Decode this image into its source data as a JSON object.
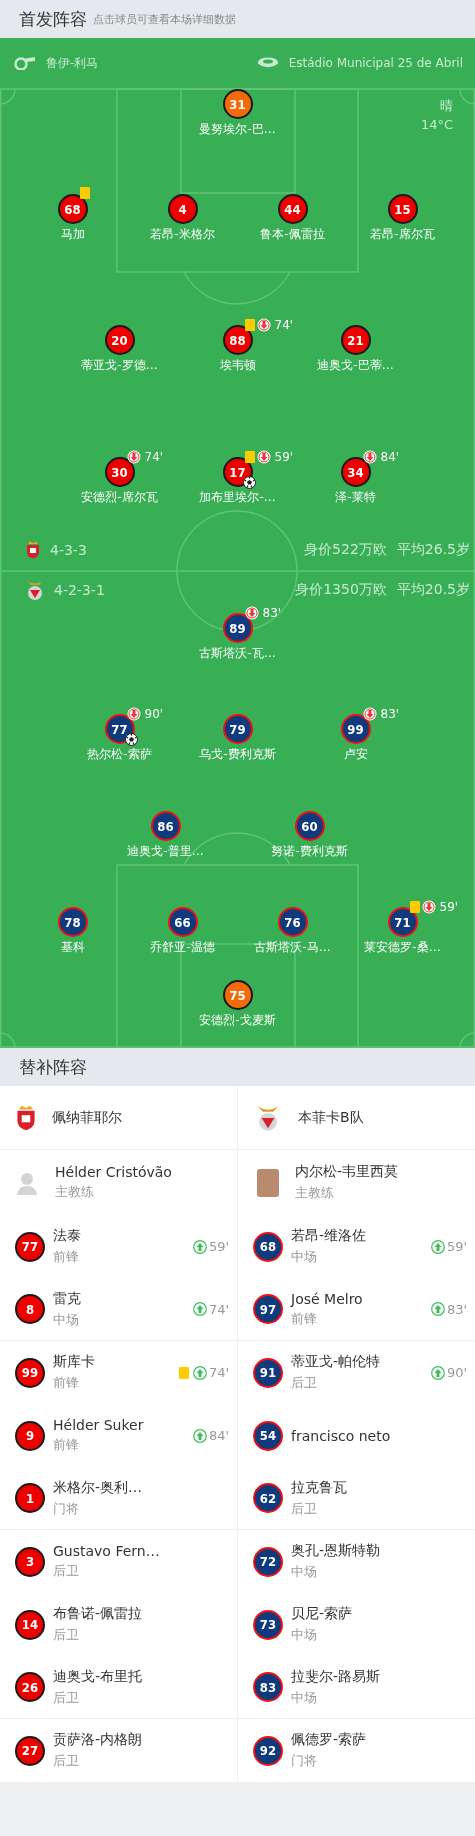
{
  "header": {
    "title": "首发阵容",
    "hint": "点击球员可查看本场详细数据"
  },
  "pitch": {
    "referee": "鲁伊-利马",
    "stadium": "Estádio Municipal 25 de Abril",
    "weather": "晴",
    "temperature": "14°C",
    "home_lines": [
      [
        {
          "number": "31",
          "name": "曼努埃尔-巴…",
          "kind": "goalkeeper",
          "yellow_card": false,
          "goal": false
        }
      ],
      [
        {
          "number": "68",
          "name": "马加",
          "kind": "outfield",
          "yellow_card": true,
          "goal": false
        },
        {
          "number": "4",
          "name": "若昂-米格尔",
          "kind": "outfield",
          "yellow_card": false,
          "goal": false
        },
        {
          "number": "44",
          "name": "鲁本-佩雷拉",
          "kind": "outfield",
          "yellow_card": false,
          "goal": false
        },
        {
          "number": "15",
          "name": "若昂-席尔瓦",
          "kind": "outfield",
          "yellow_card": false,
          "goal": false
        }
      ],
      [
        {
          "number": "20",
          "name": "蒂亚戈-罗德…",
          "kind": "outfield",
          "yellow_card": false,
          "goal": false
        },
        {
          "number": "88",
          "name": "埃韦顿",
          "kind": "outfield",
          "yellow_card": true,
          "subbed_off": "74'",
          "goal": false
        },
        {
          "number": "21",
          "name": "迪奥戈-巴蒂…",
          "kind": "outfield",
          "yellow_card": false,
          "goal": false
        }
      ],
      [
        {
          "number": "30",
          "name": "安德烈-席尔瓦",
          "kind": "outfield",
          "yellow_card": false,
          "subbed_off": "74'",
          "goal": false
        },
        {
          "number": "17",
          "name": "加布里埃尔-…",
          "kind": "outfield",
          "yellow_card": true,
          "subbed_off": "59'",
          "goal": true
        },
        {
          "number": "34",
          "name": "泽-莱特",
          "kind": "outfield",
          "yellow_card": false,
          "subbed_off": "84'",
          "goal": false
        }
      ]
    ],
    "formations": [
      {
        "formation": "4-3-3",
        "value": "身价522万欧",
        "average_age": "平均26.5岁"
      },
      {
        "formation": "4-2-3-1",
        "value": "身价1350万欧",
        "average_age": "平均20.5岁"
      }
    ],
    "away_lines": [
      [
        {
          "number": "89",
          "name": "古斯塔沃-瓦…",
          "kind": "outfield",
          "yellow_card": false,
          "subbed_off": "83'",
          "goal": false
        }
      ],
      [
        {
          "number": "77",
          "name": "热尔松-索萨",
          "kind": "outfield",
          "yellow_card": false,
          "subbed_off": "90'",
          "goal": true
        },
        {
          "number": "79",
          "name": "乌戈-费利克斯",
          "kind": "outfield",
          "yellow_card": false,
          "goal": false
        },
        {
          "number": "99",
          "name": "卢安",
          "kind": "outfield",
          "yellow_card": false,
          "subbed_off": "83'",
          "goal": false
        }
      ],
      [
        {
          "number": "86",
          "name": "迪奥戈-普里…",
          "kind": "outfield",
          "yellow_card": false,
          "goal": false
        },
        {
          "number": "60",
          "name": "努诺-费利克斯",
          "kind": "outfield",
          "yellow_card": false,
          "goal": false
        }
      ],
      [
        {
          "number": "78",
          "name": "基科",
          "kind": "outfield",
          "yellow_card": false,
          "goal": false
        },
        {
          "number": "66",
          "name": "乔舒亚-温德",
          "kind": "outfield",
          "yellow_card": false,
          "goal": false
        },
        {
          "number": "76",
          "name": "古斯塔沃-马…",
          "kind": "outfield",
          "yellow_card": false,
          "goal": false
        },
        {
          "number": "71",
          "name": "莱安德罗-桑…",
          "kind": "outfield",
          "yellow_card": true,
          "subbed_off": "59'",
          "goal": false
        }
      ],
      [
        {
          "number": "75",
          "name": "安德烈-戈麦斯",
          "kind": "goalkeeper",
          "yellow_card": false,
          "goal": false
        }
      ]
    ]
  },
  "bench": {
    "title": "替补阵容",
    "teams": [
      {
        "name": "佩纳菲耶尔",
        "coach": {
          "name": "Hélder Cristóvão",
          "role": "主教练",
          "kind": "silhouette"
        },
        "players": [
          {
            "number": "77",
            "name": "法泰",
            "position": "前锋",
            "yellow_card": false,
            "subbed_on": "59'"
          },
          {
            "number": "8",
            "name": "雷克",
            "position": "中场",
            "yellow_card": false,
            "subbed_on": "74'"
          },
          {
            "number": "99",
            "name": "斯库卡",
            "position": "前锋",
            "yellow_card": true,
            "subbed_on": "74'"
          },
          {
            "number": "9",
            "name": "Hélder Suker",
            "position": "前锋",
            "yellow_card": false,
            "subbed_on": "84'"
          },
          {
            "number": "1",
            "name": "米格尔-奥利…",
            "position": "门将",
            "yellow_card": false
          },
          {
            "number": "3",
            "name": "Gustavo Fern…",
            "position": "后卫",
            "yellow_card": false
          },
          {
            "number": "14",
            "name": "布鲁诺-佩雷拉",
            "position": "后卫",
            "yellow_card": false
          },
          {
            "number": "26",
            "name": "迪奥戈-布里托",
            "position": "后卫",
            "yellow_card": false
          },
          {
            "number": "27",
            "name": "贡萨洛-内格朗",
            "position": "后卫",
            "yellow_card": false
          }
        ]
      },
      {
        "name": "本菲卡B队",
        "coach": {
          "name": "内尔松-韦里西莫",
          "role": "主教练",
          "kind": "photo"
        },
        "players": [
          {
            "number": "68",
            "name": "若昂-维洛佐",
            "position": "中场",
            "yellow_card": false,
            "subbed_on": "59'"
          },
          {
            "number": "97",
            "name": "José Melro",
            "position": "前锋",
            "yellow_card": false,
            "subbed_on": "83'"
          },
          {
            "number": "91",
            "name": "蒂亚戈-帕伦特",
            "position": "后卫",
            "yellow_card": false,
            "subbed_on": "90'"
          },
          {
            "number": "54",
            "name": "francisco neto",
            "yellow_card": false
          },
          {
            "number": "62",
            "name": "拉克鲁瓦",
            "position": "后卫",
            "yellow_card": false
          },
          {
            "number": "72",
            "name": "奥孔-恩斯特勒",
            "position": "中场",
            "yellow_card": false
          },
          {
            "number": "73",
            "name": "贝尼-索萨",
            "position": "中场",
            "yellow_card": false
          },
          {
            "number": "83",
            "name": "拉斐尔-路易斯",
            "position": "中场",
            "yellow_card": false
          },
          {
            "number": "92",
            "name": "佩德罗-索萨",
            "position": "门将",
            "yellow_card": false
          }
        ]
      }
    ]
  }
}
